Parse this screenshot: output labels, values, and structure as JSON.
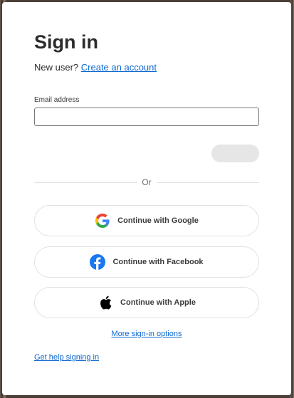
{
  "signin": {
    "title": "Sign in",
    "new_user_text": "New user?",
    "create_account_link": "Create an account",
    "email_label": "Email address",
    "email_value": "",
    "divider_text": "Or",
    "social_buttons": {
      "google": "Continue with Google",
      "facebook": "Continue with Facebook",
      "apple": "Continue with Apple"
    },
    "more_options_link": "More sign-in options",
    "help_link": "Get help signing in"
  },
  "icons": {
    "google": "google-icon",
    "facebook": "facebook-icon",
    "apple": "apple-icon"
  },
  "colors": {
    "link": "#0d66d0",
    "facebook": "#1877f2",
    "continue_disabled": "#e6e6e6"
  }
}
